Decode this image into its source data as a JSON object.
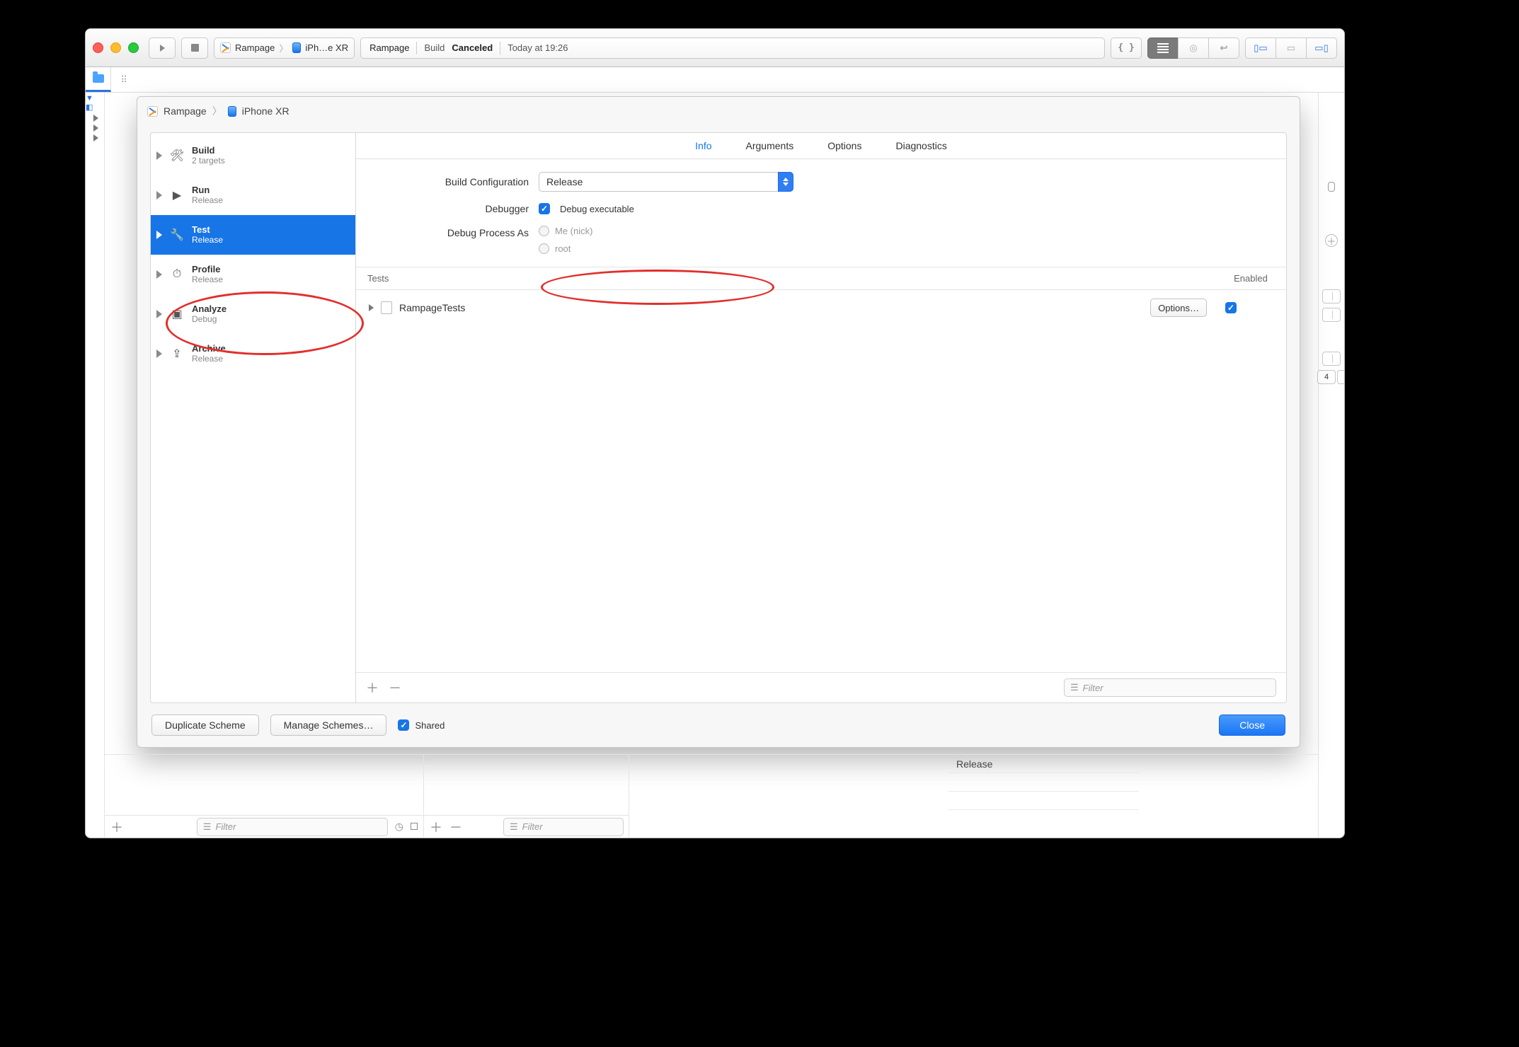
{
  "toolbar": {
    "scheme": "Rampage",
    "destination": "iPh…e XR",
    "status_project": "Rampage",
    "status_prefix": "Build",
    "status_action": "Canceled",
    "status_time": "Today at 19:26"
  },
  "sheet": {
    "crumb_project": "Rampage",
    "crumb_device": "iPhone XR",
    "actions": [
      {
        "name": "Build",
        "sub": "2 targets"
      },
      {
        "name": "Run",
        "sub": "Release"
      },
      {
        "name": "Test",
        "sub": "Release"
      },
      {
        "name": "Profile",
        "sub": "Release"
      },
      {
        "name": "Analyze",
        "sub": "Debug"
      },
      {
        "name": "Archive",
        "sub": "Release"
      }
    ],
    "tabs": {
      "info": "Info",
      "arguments": "Arguments",
      "options": "Options",
      "diagnostics": "Diagnostics"
    },
    "labels": {
      "build_config": "Build Configuration",
      "debugger": "Debugger",
      "debug_exec": "Debug executable",
      "debug_as": "Debug Process As",
      "me": "Me (nick)",
      "root": "root"
    },
    "values": {
      "build_config": "Release"
    },
    "tests": {
      "header_tests": "Tests",
      "header_enabled": "Enabled",
      "target": "RampageTests",
      "options_btn": "Options…",
      "filter_placeholder": "Filter"
    },
    "buttons": {
      "duplicate": "Duplicate Scheme",
      "manage": "Manage Schemes…",
      "shared": "Shared",
      "close": "Close"
    }
  },
  "below": {
    "release_label": "Release",
    "filter_placeholder": "Filter",
    "num4": "4"
  }
}
